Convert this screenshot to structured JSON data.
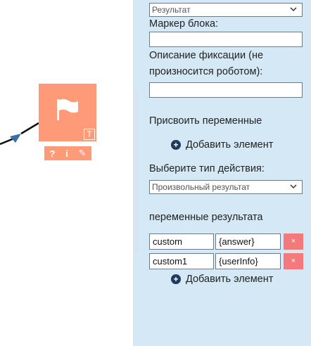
{
  "node": {
    "type_badge": "T",
    "tools": {
      "help": "?",
      "info": "i",
      "edit": "✎"
    }
  },
  "panel": {
    "top_select_value": "Результат",
    "marker_label": "Маркер блока:",
    "marker_value": "",
    "description_label_1": "Описание фиксации (не",
    "description_label_2": "произносится роботом):",
    "description_value": "",
    "assign_vars_label": "Присвоить переменные",
    "add_element_1": "Добавить элемент",
    "action_type_label": "Выберите тип действия:",
    "action_type_value": "Произвольный результат",
    "result_vars_label": "переменные результата",
    "rows": [
      {
        "name": "custom",
        "value": "{answer}",
        "delete": "×"
      },
      {
        "name": "custom1",
        "value": "{userInfo}",
        "delete": "×"
      }
    ],
    "add_element_2": "Добавить элемент"
  },
  "colors": {
    "node": "#ff9a78",
    "panel": "#d4e8f6",
    "delete": "#f27a7a",
    "edge": "#111111",
    "arrow": "#3a6ea5"
  },
  "icons": {
    "node": "flag-icon",
    "dropdown": "chevron-down-icon",
    "add": "plus-circle-icon"
  }
}
